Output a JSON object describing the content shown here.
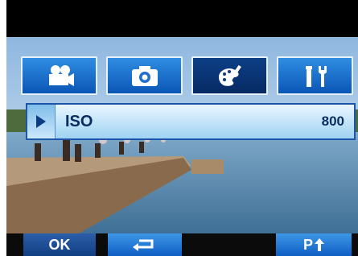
{
  "tabs": [
    {
      "id": "movie",
      "icon": "movie-camera-icon",
      "active": false
    },
    {
      "id": "photo",
      "icon": "camera-icon",
      "active": false
    },
    {
      "id": "effects",
      "icon": "palette-brush-icon",
      "active": true
    },
    {
      "id": "setup",
      "icon": "wrench-screwdriver-icon",
      "active": false
    }
  ],
  "setting": {
    "label": "ISO",
    "value": "800"
  },
  "softkeys": {
    "ok_label": "OK",
    "back_icon": "return-arrow-icon",
    "page_label": "P"
  },
  "colors": {
    "tab_blue": "#1f78d1",
    "tab_active": "#0b3b80",
    "row_light": "#bfe3f7",
    "text_dark": "#0b2d60"
  }
}
